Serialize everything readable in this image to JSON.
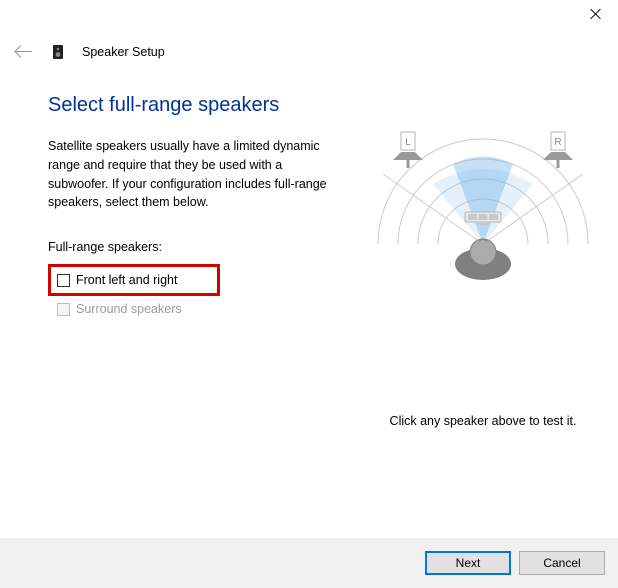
{
  "window": {
    "title": "Speaker Setup"
  },
  "heading": "Select full-range speakers",
  "description": "Satellite speakers usually have a limited dynamic range and require that they be used with a subwoofer.  If your configuration includes full-range speakers, select them below.",
  "listHeader": "Full-range speakers:",
  "options": {
    "front": {
      "label": "Front left and right",
      "checked": false,
      "enabled": true
    },
    "surround": {
      "label": "Surround speakers",
      "checked": false,
      "enabled": false
    }
  },
  "diagram": {
    "leftLabel": "L",
    "rightLabel": "R"
  },
  "hint": "Click any speaker above to test it.",
  "buttons": {
    "next": "Next",
    "cancel": "Cancel"
  }
}
